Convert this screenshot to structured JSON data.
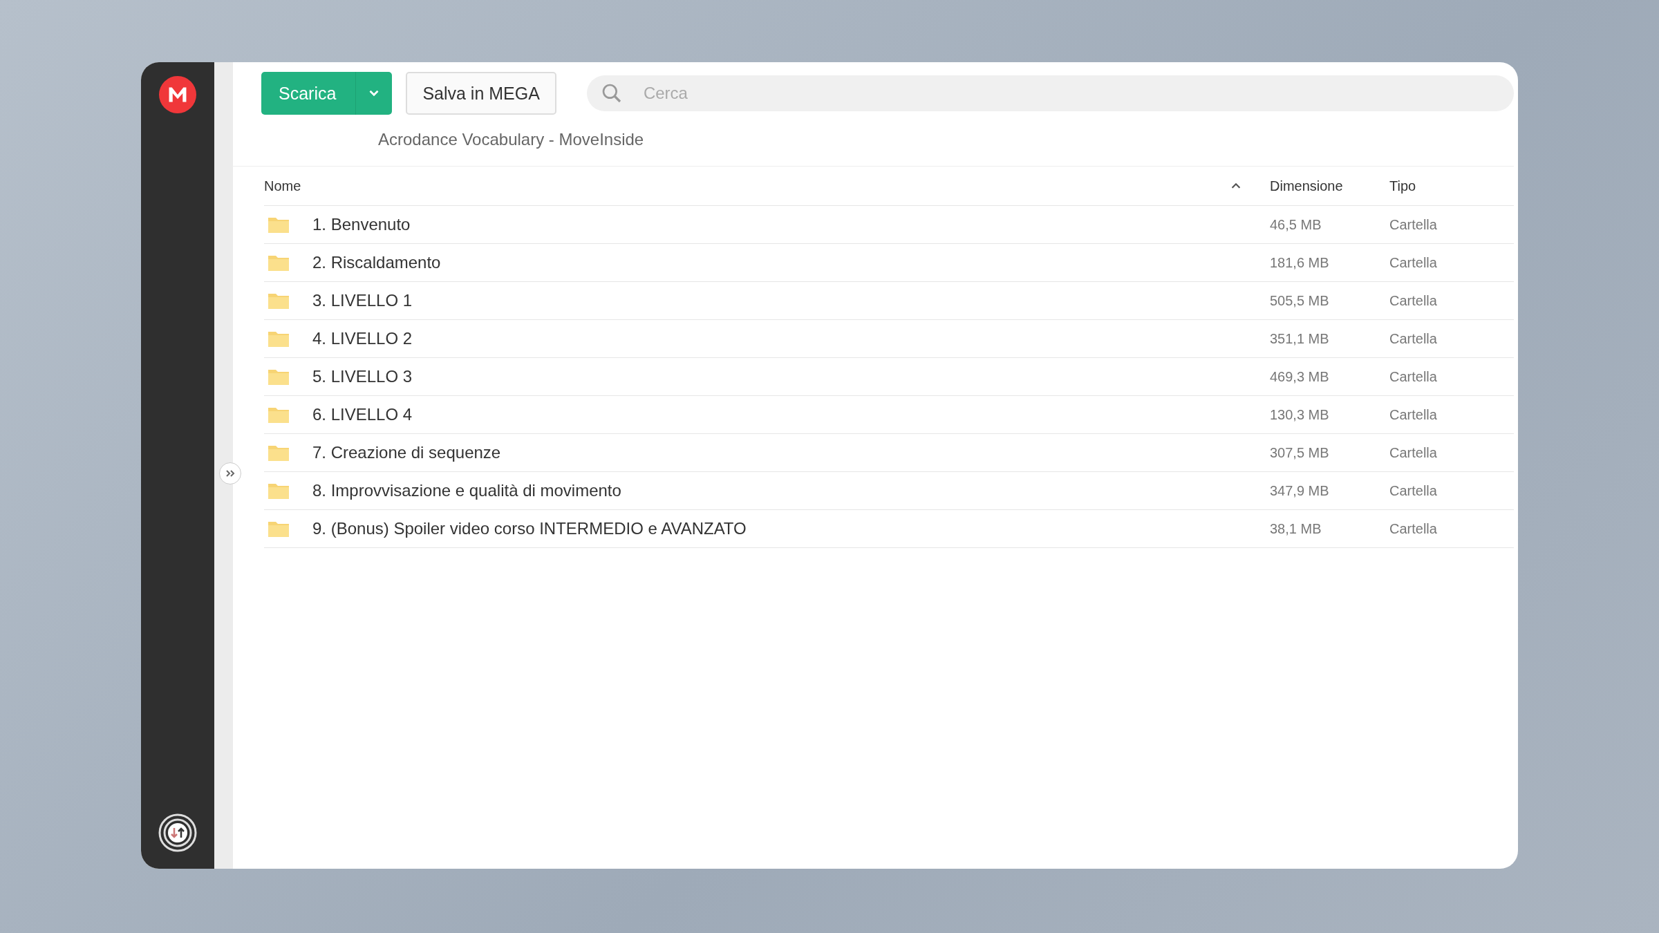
{
  "toolbar": {
    "download_button": {
      "label": "Scarica"
    },
    "save_button": {
      "label": "Salva in MEGA"
    },
    "search": {
      "placeholder": "Cerca"
    }
  },
  "folder_title": "Acrodance Vocabulary - MoveInside",
  "table": {
    "columns": [
      {
        "label": "Nome",
        "kind": "name"
      },
      {
        "label": "Dimensione",
        "kind": "size"
      },
      {
        "label": "Tipo",
        "kind": "type"
      }
    ],
    "sort_ascending": true,
    "rows": [
      {
        "name": "1. Benvenuto",
        "size": "46,5 MB",
        "type": "Cartella"
      },
      {
        "name": "2. Riscaldamento",
        "size": "181,6 MB",
        "type": "Cartella"
      },
      {
        "name": "3. LIVELLO 1",
        "size": "505,5 MB",
        "type": "Cartella"
      },
      {
        "name": "4. LIVELLO 2",
        "size": "351,1 MB",
        "type": "Cartella"
      },
      {
        "name": "5. LIVELLO 3",
        "size": "469,3 MB",
        "type": "Cartella"
      },
      {
        "name": "6. LIVELLO 4",
        "size": "130,3 MB",
        "type": "Cartella"
      },
      {
        "name": "7. Creazione di sequenze",
        "size": "307,5 MB",
        "type": "Cartella"
      },
      {
        "name": "8. Improvvisazione e qualità di movimento",
        "size": "347,9 MB",
        "type": "Cartella"
      },
      {
        "name": "9. (Bonus) Spoiler video corso INTERMEDIO e AVANZATO",
        "size": "38,1 MB",
        "type": "Cartella"
      }
    ]
  }
}
